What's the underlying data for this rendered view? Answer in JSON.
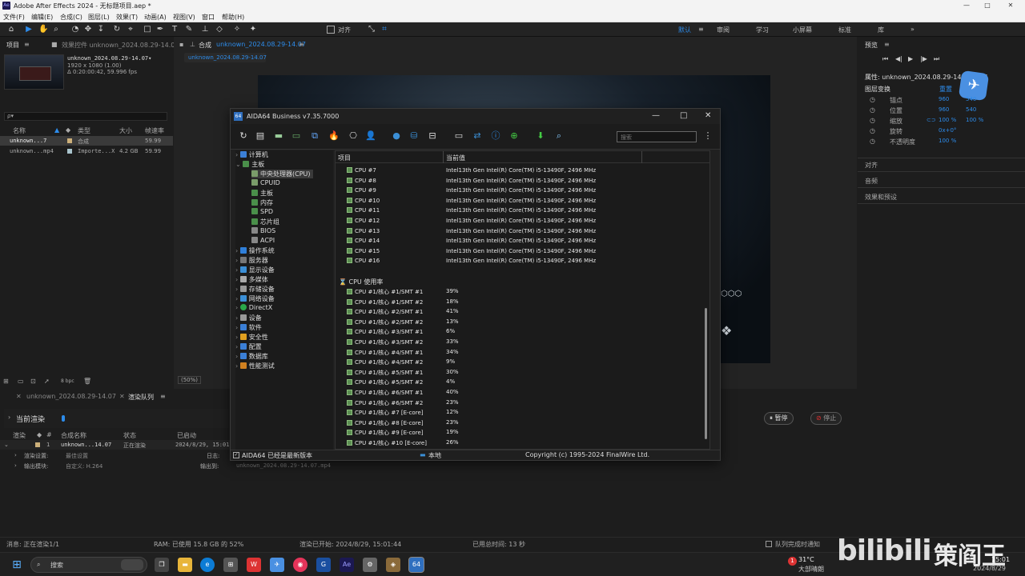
{
  "ae": {
    "window_title": "Adobe After Effects 2024 - 无标题项目.aep *",
    "app_badge": "Ae",
    "win_controls": [
      "—",
      "□",
      "✕"
    ],
    "menu": [
      "文件(F)",
      "编辑(E)",
      "合成(C)",
      "图层(L)",
      "效果(T)",
      "动画(A)",
      "视图(V)",
      "窗口",
      "帮助(H)"
    ],
    "toolbar": {
      "align_label": "对齐",
      "workspaces": [
        "默认",
        "审阅",
        "学习",
        "小屏幕",
        "标准",
        "库"
      ]
    },
    "project": {
      "tab": "项目",
      "effects_tab": "效果控件 unknown_2024.08.29-14.07",
      "comp_name": "unknown_2024.08.29-14.07▾",
      "comp_info1": "1920 x 1080 (1.00)",
      "comp_info2": "Δ 0:20:00:42, 59.996 fps",
      "search_placeholder": "ρ▾",
      "cols": {
        "name": "名称",
        "type": "类型",
        "size": "大小",
        "fps": "帧速率"
      },
      "items": [
        {
          "name": "unknown...7",
          "type": "合成",
          "size": "",
          "fps": "59.99"
        },
        {
          "name": "unknown...mp4",
          "type": "Importe...X",
          "size": "4.2 GB",
          "fps": "59.99"
        }
      ],
      "bpc": "8 bpc"
    },
    "comp": {
      "tab_prefix": "合成",
      "tab_name": "unknown_2024.08.29-14.07",
      "sub_tab": "unknown_2024.08.29-14.07",
      "zoom": "(50%)"
    },
    "right": {
      "preview": "预览",
      "props_title": "属性: unknown_2024.08.29-14.07.mp4",
      "layer_transform": "图层变换",
      "reset": "重置",
      "props": [
        {
          "n": "锚点",
          "v": "960",
          "v2": "540"
        },
        {
          "n": "位置",
          "v": "960",
          "v2": "540"
        },
        {
          "n": "缩放",
          "v": "100 %",
          "v2": "100 %"
        },
        {
          "n": "旋转",
          "v": "0x+0°",
          "v2": ""
        },
        {
          "n": "不透明度",
          "v": "100 %",
          "v2": ""
        }
      ],
      "sections": [
        "对齐",
        "音频",
        "效果和预设"
      ]
    },
    "render": {
      "tab1": "unknown_2024.08.29-14.07",
      "tab2": "渲染队列",
      "current": "当前渲染",
      "cols": [
        "渲染",
        "#",
        "合成名称",
        "状态",
        "已启动"
      ],
      "row": {
        "num": "1",
        "comp": "unknown...14.07",
        "status": "正在渲染",
        "started": "2024/8/29, 15:01"
      },
      "render_settings_label": "渲染设置:",
      "render_settings": "最佳设置",
      "log_label": "日志:",
      "output_module_label": "输出模块:",
      "output_module": "自定义: H.264",
      "output_to_label": "输出到:",
      "output_file": "unknown_2024.08.29-14.07.mp4",
      "pause": "暂停",
      "stop": "停止"
    },
    "statusbar": {
      "msg": "消息: 正在渲染1/1",
      "ram": "RAM: 已使用 15.8 GB 的 52%",
      "started": "渲染已开始: 2024/8/29, 15:01:44",
      "elapsed": "已用总时间: 13 秒",
      "notify": "队列完成时通知"
    }
  },
  "aida": {
    "title": "AIDA64 Business v7.35.7000",
    "icon": "64",
    "search_placeholder": "搜索",
    "tree": [
      {
        "label": "计算机",
        "lvl": 0,
        "color": "#3b7fd6"
      },
      {
        "label": "主板",
        "lvl": 0,
        "color": "#4a8f4a",
        "open": true
      },
      {
        "label": "中央处理器(CPU)",
        "lvl": 1,
        "color": "#7a9c6a",
        "sel": true
      },
      {
        "label": "CPUID",
        "lvl": 1,
        "color": "#7a9c6a"
      },
      {
        "label": "主板",
        "lvl": 1,
        "color": "#4a8f4a"
      },
      {
        "label": "内存",
        "lvl": 1,
        "color": "#4a8f4a"
      },
      {
        "label": "SPD",
        "lvl": 1,
        "color": "#4a8f4a"
      },
      {
        "label": "芯片组",
        "lvl": 1,
        "color": "#4a8f4a"
      },
      {
        "label": "BIOS",
        "lvl": 1,
        "color": "#888"
      },
      {
        "label": "ACPI",
        "lvl": 1,
        "color": "#888"
      },
      {
        "label": "操作系统",
        "lvl": 0,
        "color": "#2f7fd9"
      },
      {
        "label": "服务器",
        "lvl": 0,
        "color": "#777"
      },
      {
        "label": "显示设备",
        "lvl": 0,
        "color": "#3b8fd6"
      },
      {
        "label": "多媒体",
        "lvl": 0,
        "color": "#aaa"
      },
      {
        "label": "存储设备",
        "lvl": 0,
        "color": "#999"
      },
      {
        "label": "网络设备",
        "lvl": 0,
        "color": "#3b8fd6"
      },
      {
        "label": "DirectX",
        "lvl": 0,
        "color": "#2aa84a"
      },
      {
        "label": "设备",
        "lvl": 0,
        "color": "#999"
      },
      {
        "label": "软件",
        "lvl": 0,
        "color": "#3b7fd6"
      },
      {
        "label": "安全性",
        "lvl": 0,
        "color": "#e0a020"
      },
      {
        "label": "配置",
        "lvl": 0,
        "color": "#3b7fd6"
      },
      {
        "label": "数据库",
        "lvl": 0,
        "color": "#3b7fd6"
      },
      {
        "label": "性能测试",
        "lvl": 0,
        "color": "#d08020"
      }
    ],
    "list_cols": {
      "item": "项目",
      "value": "当前值"
    },
    "cpu_rows": [
      {
        "n": "CPU #7",
        "v": "Intel13th Gen Intel(R) Core(TM) i5-13490F, 2496 MHz"
      },
      {
        "n": "CPU #8",
        "v": "Intel13th Gen Intel(R) Core(TM) i5-13490F, 2496 MHz"
      },
      {
        "n": "CPU #9",
        "v": "Intel13th Gen Intel(R) Core(TM) i5-13490F, 2496 MHz"
      },
      {
        "n": "CPU #10",
        "v": "Intel13th Gen Intel(R) Core(TM) i5-13490F, 2496 MHz"
      },
      {
        "n": "CPU #11",
        "v": "Intel13th Gen Intel(R) Core(TM) i5-13490F, 2496 MHz"
      },
      {
        "n": "CPU #12",
        "v": "Intel13th Gen Intel(R) Core(TM) i5-13490F, 2496 MHz"
      },
      {
        "n": "CPU #13",
        "v": "Intel13th Gen Intel(R) Core(TM) i5-13490F, 2496 MHz"
      },
      {
        "n": "CPU #14",
        "v": "Intel13th Gen Intel(R) Core(TM) i5-13490F, 2496 MHz"
      },
      {
        "n": "CPU #15",
        "v": "Intel13th Gen Intel(R) Core(TM) i5-13490F, 2496 MHz"
      },
      {
        "n": "CPU #16",
        "v": "Intel13th Gen Intel(R) Core(TM) i5-13490F, 2496 MHz"
      }
    ],
    "usage_header": "CPU 使用率",
    "usage_rows": [
      {
        "n": "CPU #1/核心 #1/SMT #1",
        "v": "39%"
      },
      {
        "n": "CPU #1/核心 #1/SMT #2",
        "v": "18%"
      },
      {
        "n": "CPU #1/核心 #2/SMT #1",
        "v": "41%"
      },
      {
        "n": "CPU #1/核心 #2/SMT #2",
        "v": "13%"
      },
      {
        "n": "CPU #1/核心 #3/SMT #1",
        "v": "6%"
      },
      {
        "n": "CPU #1/核心 #3/SMT #2",
        "v": "33%"
      },
      {
        "n": "CPU #1/核心 #4/SMT #1",
        "v": "34%"
      },
      {
        "n": "CPU #1/核心 #4/SMT #2",
        "v": "9%"
      },
      {
        "n": "CPU #1/核心 #5/SMT #1",
        "v": "30%"
      },
      {
        "n": "CPU #1/核心 #5/SMT #2",
        "v": "4%"
      },
      {
        "n": "CPU #1/核心 #6/SMT #1",
        "v": "40%"
      },
      {
        "n": "CPU #1/核心 #6/SMT #2",
        "v": "23%"
      },
      {
        "n": "CPU #1/核心 #7 [E-core]",
        "v": "12%"
      },
      {
        "n": "CPU #1/核心 #8 [E-core]",
        "v": "23%"
      },
      {
        "n": "CPU #1/核心 #9 [E-core]",
        "v": "19%"
      },
      {
        "n": "CPU #1/核心 #10 [E-core]",
        "v": "26%"
      }
    ],
    "status_left": "AIDA64 已经是最新版本",
    "status_mid": "本地",
    "status_right": "Copyright (c) 1995-2024 FinalWire Ltd."
  },
  "taskbar": {
    "search": "搜索",
    "weather_temp": "31°C",
    "weather_desc": "大部晴朗",
    "weather_badge": "1",
    "time": "15:01",
    "date": "2024/8/29",
    "watermark": "bilibili",
    "watermark2": "策阎王"
  }
}
